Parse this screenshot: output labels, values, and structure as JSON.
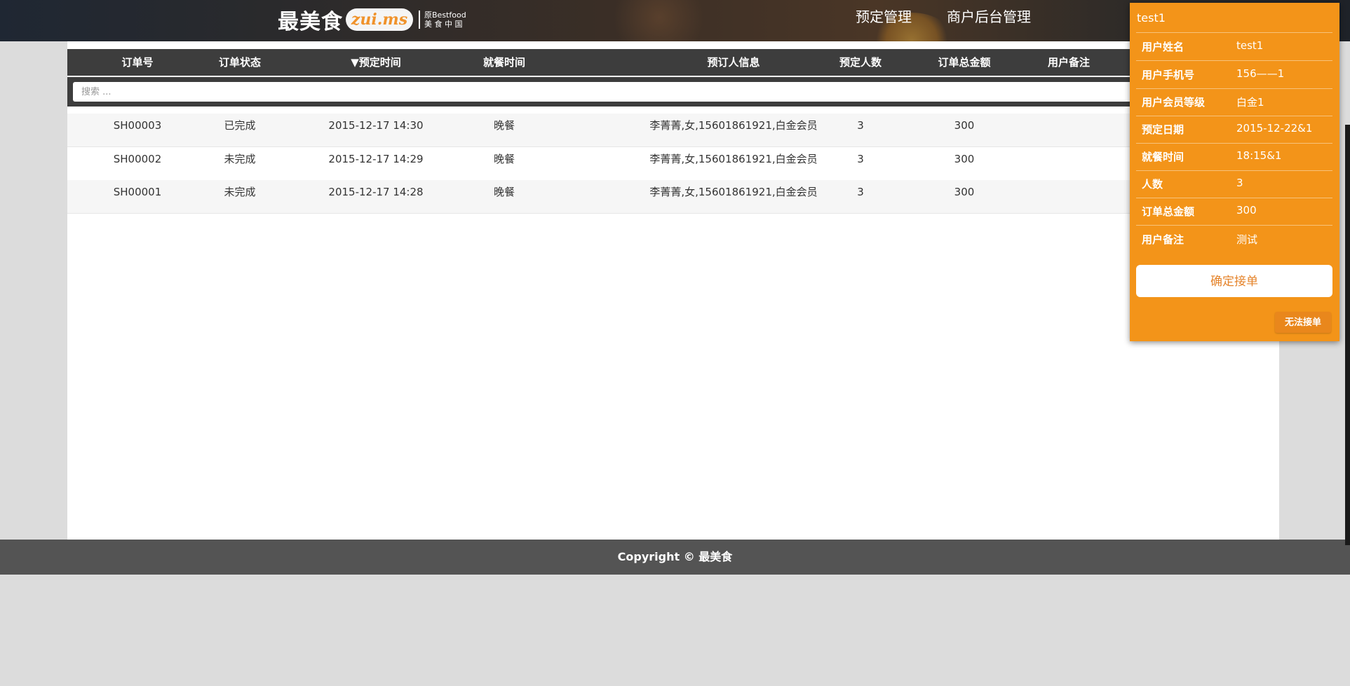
{
  "header": {
    "logo_cn": "最美食",
    "logo_badge": "zui.ms",
    "logo_sub_line1": "原Bestfood",
    "logo_sub_line2": "美 食 中 国",
    "nav": [
      "预定管理",
      "商户后台管理"
    ]
  },
  "table": {
    "columns": [
      "订单号",
      "订单状态",
      "▼预定时间",
      "就餐时间",
      "预订人信息",
      "预定人数",
      "订单总金额",
      "用户备注"
    ],
    "search_placeholder": "搜索 ...",
    "rows": [
      [
        "SH00003",
        "已完成",
        "2015-12-17 14:30",
        "晚餐",
        "李菁菁,女,15601861921,白金会员",
        "3",
        "300",
        ""
      ],
      [
        "SH00002",
        "未完成",
        "2015-12-17 14:29",
        "晚餐",
        "李菁菁,女,15601861921,白金会员",
        "3",
        "300",
        ""
      ],
      [
        "SH00001",
        "未完成",
        "2015-12-17 14:28",
        "晚餐",
        "李菁菁,女,15601861921,白金会员",
        "3",
        "300",
        ""
      ]
    ]
  },
  "footer": {
    "text": "Copyright © 最美食"
  },
  "popup": {
    "title": "test1",
    "fields": [
      {
        "label": "用户姓名",
        "value": "test1"
      },
      {
        "label": "用户手机号",
        "value": "156——1"
      },
      {
        "label": "用户会员等级",
        "value": "白金1"
      },
      {
        "label": "预定日期",
        "value": "2015-12-22&1"
      },
      {
        "label": "就餐时间",
        "value": "18:15&1"
      },
      {
        "label": "人数",
        "value": "3"
      },
      {
        "label": "订单总金额",
        "value": "300"
      },
      {
        "label": "用户备注",
        "value": "测试"
      }
    ],
    "confirm_label": "确定接单",
    "reject_label": "无法接单"
  },
  "colors": {
    "header_bar": "#3d3d3d",
    "popup_bg": "#f39419",
    "accent_text": "#e5832a",
    "footer_bg": "#545454",
    "page_bg": "#dcdcdc"
  }
}
